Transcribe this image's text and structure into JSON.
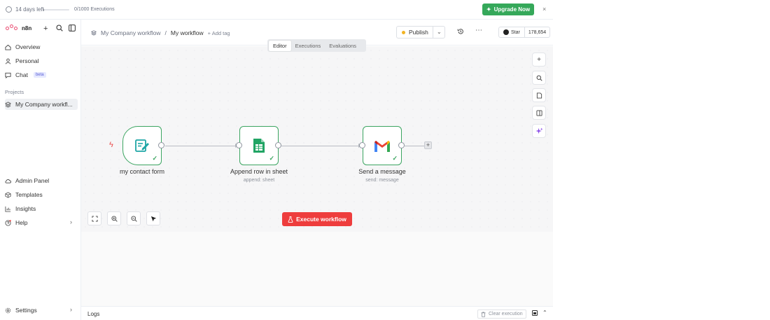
{
  "banner": {
    "days_left": "14 days left",
    "executions": "0/1000 Executions",
    "execution_fraction": 0.0,
    "upgrade_label": "Upgrade Now",
    "close_glyph": "×"
  },
  "sidebar": {
    "logo_text": "n8n",
    "items": [
      {
        "label": "Overview",
        "icon": "home-icon"
      },
      {
        "label": "Personal",
        "icon": "user-icon"
      },
      {
        "label": "Chat",
        "icon": "chat-icon",
        "badge": "beta"
      }
    ],
    "projects_label": "Projects",
    "project": "My Company workfl...",
    "bottom_items": [
      {
        "label": "Admin Panel",
        "icon": "cloud-icon"
      },
      {
        "label": "Templates",
        "icon": "box-icon"
      },
      {
        "label": "Insights",
        "icon": "chart-icon"
      },
      {
        "label": "Help",
        "icon": "help-icon"
      }
    ],
    "settings_label": "Settings"
  },
  "header": {
    "project_crumb": "My Company workflow",
    "separator": "/",
    "workflow_name": "My workflow",
    "add_tag": "+ Add tag",
    "publish_label": "Publish",
    "github_star": "Star",
    "github_count": "178,654"
  },
  "tabs": {
    "items": [
      "Editor",
      "Executions",
      "Evaluations"
    ],
    "active": "Editor"
  },
  "nodes": [
    {
      "label": "my contact form",
      "sub": ""
    },
    {
      "label": "Append row in sheet",
      "sub": "append: sheet"
    },
    {
      "label": "Send a message",
      "sub": "send: message"
    }
  ],
  "canvas": {
    "execute_label": "Execute workflow",
    "add_node_glyph": "+"
  },
  "logs": {
    "label": "Logs",
    "clear_label": "Clear execution"
  },
  "colors": {
    "accent_green": "#35a85a",
    "node_border": "#3ca561",
    "execute_red": "#ee3d3d",
    "brand_pink": "#ea4b71"
  }
}
